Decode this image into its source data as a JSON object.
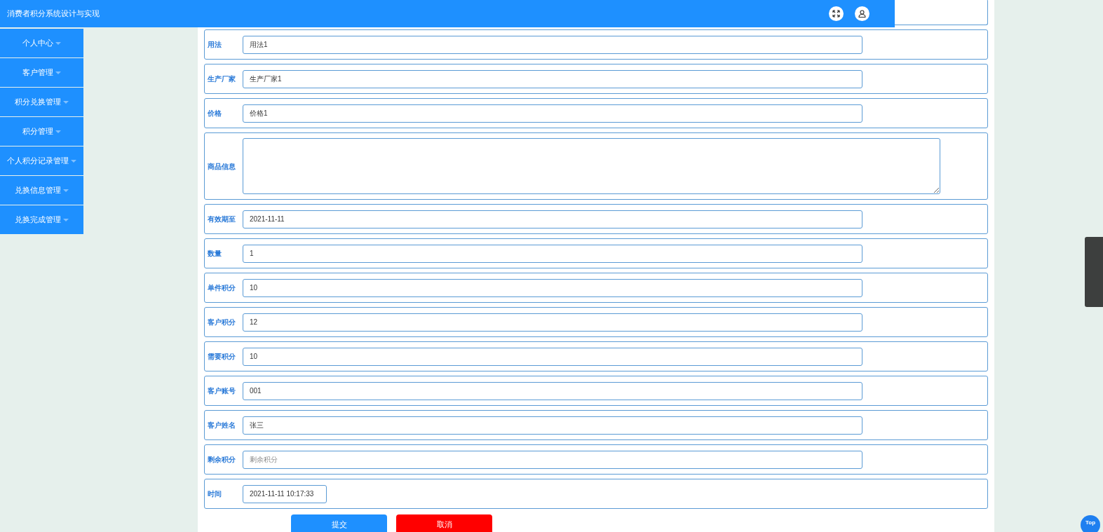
{
  "header": {
    "title": "消费者积分系统设计与实现"
  },
  "sidebar": {
    "items": [
      {
        "label": "个人中心"
      },
      {
        "label": "客户管理"
      },
      {
        "label": "积分兑换管理"
      },
      {
        "label": "积分管理"
      },
      {
        "label": "个人积分记录管理"
      },
      {
        "label": "兑换信息管理"
      },
      {
        "label": "兑换完成管理"
      }
    ]
  },
  "form": {
    "fields": [
      {
        "kind": "input",
        "label": "用法",
        "value": "用法1"
      },
      {
        "kind": "input",
        "label": "生产厂家",
        "value": "生产厂家1"
      },
      {
        "kind": "input",
        "label": "价格",
        "value": "价格1"
      },
      {
        "kind": "textarea",
        "label": "商品信息"
      },
      {
        "kind": "input",
        "label": "有效期至",
        "value": "2021-11-11"
      },
      {
        "kind": "input",
        "label": "数量",
        "value": "1"
      },
      {
        "kind": "input",
        "label": "单件积分",
        "value": "10"
      },
      {
        "kind": "input",
        "label": "客户积分",
        "value": "12"
      },
      {
        "kind": "input",
        "label": "需要积分",
        "value": "10"
      },
      {
        "kind": "input",
        "label": "客户账号",
        "value": "001"
      },
      {
        "kind": "input",
        "label": "客户姓名",
        "value": "张三"
      },
      {
        "kind": "input",
        "label": "剩余积分",
        "placeholder": "剩余积分"
      },
      {
        "kind": "short",
        "label": "时间",
        "value": "2021-11-11 10:17:33"
      }
    ],
    "buttons": [
      {
        "kind": "submit",
        "label": "提交"
      },
      {
        "kind": "cancel",
        "label": "取消"
      }
    ]
  },
  "back_to_top": {
    "label": "Top"
  }
}
